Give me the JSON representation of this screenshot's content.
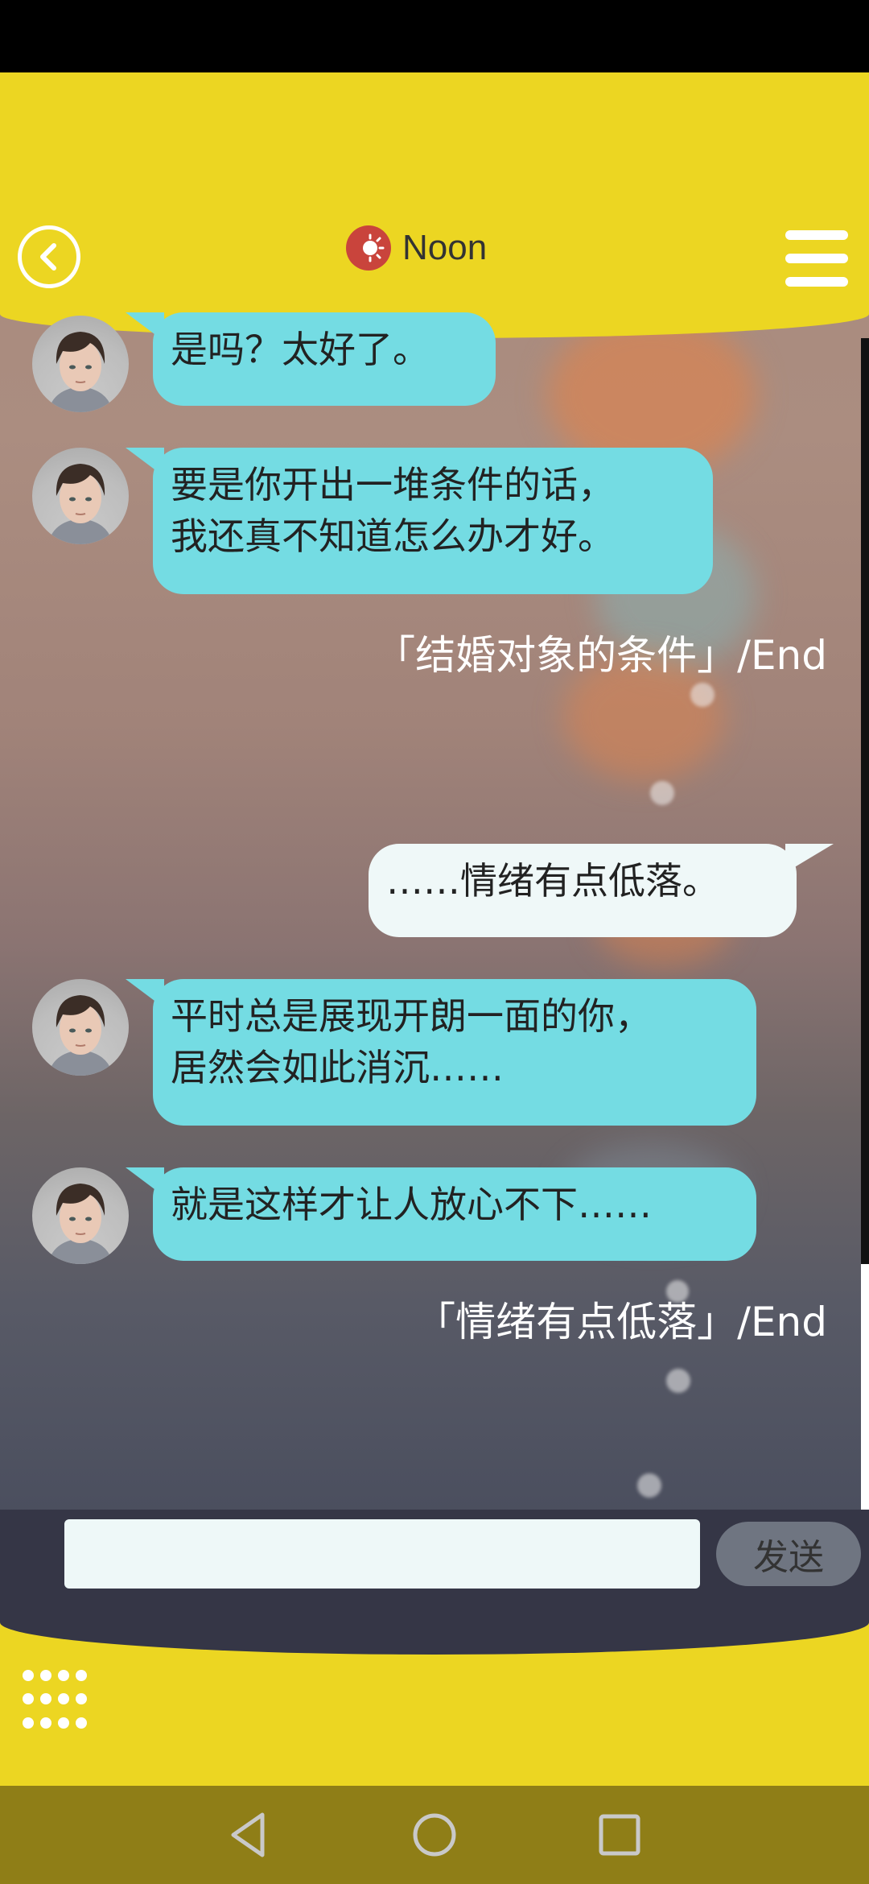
{
  "header": {
    "title": "Noon",
    "back_icon": "back-arrow-circle-icon",
    "time_icon": "sun-icon",
    "menu_icon": "hamburger-menu-icon"
  },
  "messages": [
    {
      "side": "left",
      "text": "是吗？太好了。"
    },
    {
      "side": "left",
      "text": "要是你开出一堆条件的话，\n我还真不知道怎么办才好。"
    },
    {
      "side": "system",
      "text": "「结婚对象的条件」/End"
    },
    {
      "side": "right",
      "text": "……情绪有点低落。"
    },
    {
      "side": "left",
      "text": "平时总是展现开朗一面的你，\n居然会如此消沉……"
    },
    {
      "side": "left",
      "text": "就是这样才让人放心不下……"
    },
    {
      "side": "system",
      "text": "「情绪有点低落」/End"
    }
  ],
  "composer": {
    "input_value": "",
    "send_label": "发送"
  },
  "colors": {
    "header_yellow": "#ecd622",
    "bubble_left": "#74dce3",
    "bubble_right": "#eff8f8",
    "input_bar": "#353646",
    "nav_bar": "#8f7e17"
  }
}
